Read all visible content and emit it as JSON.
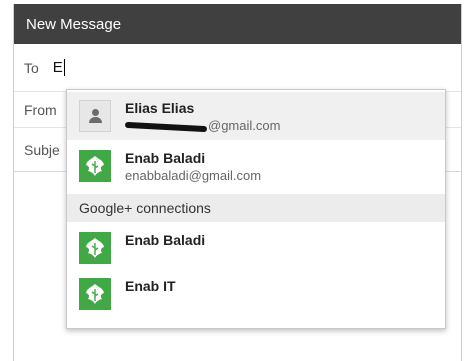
{
  "window": {
    "title": "New Message"
  },
  "fields": {
    "to_label": "To",
    "to_value": "E",
    "from_label": "From",
    "subject_label": "Subje"
  },
  "suggestions": {
    "contacts": [
      {
        "name": "Elias Elias",
        "email_visible": "@gmail.com",
        "avatar": "person-icon",
        "selected": true
      },
      {
        "name": "Enab Baladi",
        "email_visible": "enabbaladi@gmail.com",
        "avatar": "leaf-logo-icon",
        "selected": false
      }
    ],
    "section_header": "Google+ connections",
    "connections": [
      {
        "name": "Enab Baladi",
        "avatar": "leaf-logo-icon"
      },
      {
        "name": "Enab IT",
        "avatar": "leaf-logo-icon"
      }
    ]
  },
  "colors": {
    "titlebar": "#404040",
    "avatar_green": "#41a846",
    "selected_row": "#f0f0f0"
  }
}
